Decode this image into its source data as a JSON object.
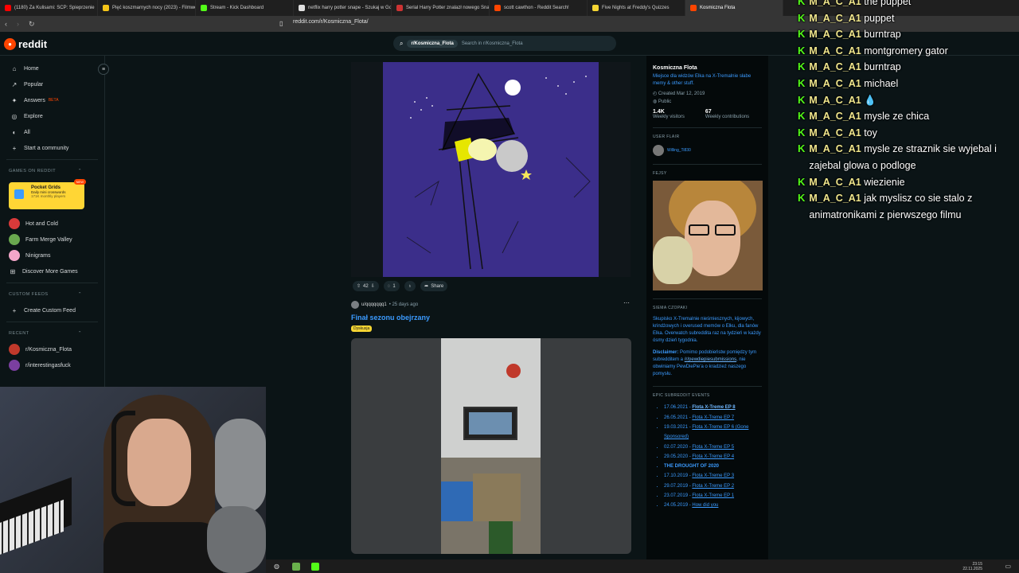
{
  "browser": {
    "tabs": [
      {
        "label": "(1180) Za Kulisami: SCP: Spieprzenie",
        "color": "#ff0000"
      },
      {
        "label": "Pięć koszmarnych nocy (2023) - Filmweb",
        "color": "#f5c518"
      },
      {
        "label": "Stream - Kick Dashboard",
        "color": "#53fc18"
      },
      {
        "label": "netflix harry potter snape - Szukaj w Google",
        "color": "#e0e0e0"
      },
      {
        "label": "Serial Harry Potter znalazł nowego Snape'a",
        "color": "#c33"
      },
      {
        "label": "scott cawthon - Reddit Search!",
        "color": "#ff4500"
      },
      {
        "label": "Five Nights at Freddy's Quizzes",
        "color": "#f5d533"
      },
      {
        "label": "Kosmiczna Flota",
        "color": "#ff4500"
      }
    ],
    "url": "reddit.com/r/Kosmiczna_Flota/"
  },
  "reddit": {
    "logo": "reddit",
    "search_chip": "r/Kosmiczna_Flota",
    "search_placeholder": "Search in r/Kosmiczna_Flota"
  },
  "sidebar": {
    "main": [
      {
        "label": "Home",
        "icon": "⌂"
      },
      {
        "label": "Popular",
        "icon": "↗"
      },
      {
        "label": "Answers",
        "badge": "BETA",
        "icon": "✦"
      },
      {
        "label": "Explore",
        "icon": "◎"
      },
      {
        "label": "All",
        "icon": "◐"
      },
      {
        "label": "Start a community",
        "icon": "+"
      }
    ],
    "games_header": "GAMES ON REDDIT",
    "pocket": {
      "title": "Pocket Grids",
      "sub": "Daily mini crosswords",
      "players": "171K monthly players",
      "badge": "NEW"
    },
    "games": [
      {
        "label": "Hot and Cold",
        "color": "#d93a3a"
      },
      {
        "label": "Farm Merge Valley",
        "color": "#6aa84f"
      },
      {
        "label": "Ninigrams",
        "color": "#f4a6c9"
      },
      {
        "label": "Discover More Games",
        "color": ""
      }
    ],
    "custom_header": "CUSTOM FEEDS",
    "create_feed": "Create Custom Feed",
    "recent_header": "RECENT",
    "recent": [
      {
        "label": "r/Kosmiczna_Flota",
        "color": "#c0392b"
      },
      {
        "label": "r/interestingasfuck",
        "color": "#7b3fa0"
      }
    ]
  },
  "post1": {
    "votes": "42",
    "comments": "1",
    "share": "Share"
  },
  "post2": {
    "author": "u/qqqqqqq1",
    "time": "• 25 days ago",
    "title": "Finał sezonu obejrzany",
    "flair": "Dyskusja"
  },
  "right_sidebar": {
    "name": "Kosmiczna Flota",
    "desc": "Miejsce dla widzów Elka na X-Tremalnie słabe memy & other stuff.",
    "created": "Created Mar 12, 2019",
    "visibility": "Public",
    "visitors": "1.4K",
    "visitors_label": "Weekly visitors",
    "contributions": "67",
    "contributions_label": "Weekly contributions",
    "user_flair_header": "USER FLAIR",
    "user_flair": "Willing_Ti830",
    "fejsy_header": "FEJSY",
    "siema_header": "SIEMA CZOPAKI",
    "siema_text": "Skupisko X-Tremalnie nieśmiesznych, kijowych, krindżowych i overused memów o Elku, dla fanów Elka. Overwatch subreddita raz na tydzień w każdy ósmy dzień tygodnia.",
    "disclaimer_label": "Disclaimer:",
    "disclaimer_a": "Pomimo podobieństw pomiędzy tym subredditem a",
    "disclaimer_link": "/r/pewdiepiesubmissions",
    "disclaimer_b": ", nie obwiniamy PewDiePie'a o kradzież naszego pomysłu.",
    "events_header": "EPIC SUBREDDIT EVENTS",
    "events": [
      {
        "date": "17.06.2021 -",
        "label": "Flota X-Treme EP 8"
      },
      {
        "date": "26.05.2021 -",
        "label": "Flota X-Treme EP 7"
      },
      {
        "date": "19.03.2021 -",
        "label": "Flota X-Treme EP 6 (Gone Sponsored)"
      },
      {
        "date": "02.07.2020 -",
        "label": "Flota X-Treme EP 5"
      },
      {
        "date": "29.05.2020 -",
        "label": "Flota X-Treme EP 4"
      },
      {
        "date": "",
        "label": "THE DROUGHT OF 2020"
      },
      {
        "date": "17.10.2019 -",
        "label": "Flota X-Treme EP 3"
      },
      {
        "date": "29.07.2019 -",
        "label": "Flota X-Treme EP 2"
      },
      {
        "date": "23.07.2019 -",
        "label": "Flota X-Treme EP 1"
      },
      {
        "date": "24.05.2019 -",
        "label": "How did you"
      }
    ]
  },
  "chat": [
    {
      "user": "M_A_C_A1",
      "msg": "the puppet"
    },
    {
      "user": "M_A_C_A1",
      "msg": "puppet"
    },
    {
      "user": "M_A_C_A1",
      "msg": "burntrap"
    },
    {
      "user": "M_A_C_A1",
      "msg": "montgromery gator"
    },
    {
      "user": "M_A_C_A1",
      "msg": "burntrap"
    },
    {
      "user": "M_A_C_A1",
      "msg": "michael"
    },
    {
      "user": "M_A_C_A1",
      "msg": "💧"
    },
    {
      "user": "M_A_C_A1",
      "msg": "mysle ze chica"
    },
    {
      "user": "M_A_C_A1",
      "msg": "toy"
    },
    {
      "user": "M_A_C_A1",
      "msg": "mysle ze straznik sie wyjebal i zajebal glowa o podloge"
    },
    {
      "user": "M_A_C_A1",
      "msg": "wiezienie"
    },
    {
      "user": "M_A_C_A1",
      "msg": "jak myslisz co sie stalo z animatronikami z pierwszego filmu"
    }
  ],
  "taskbar": {
    "time": "23:15",
    "date": "22.11.2025"
  }
}
